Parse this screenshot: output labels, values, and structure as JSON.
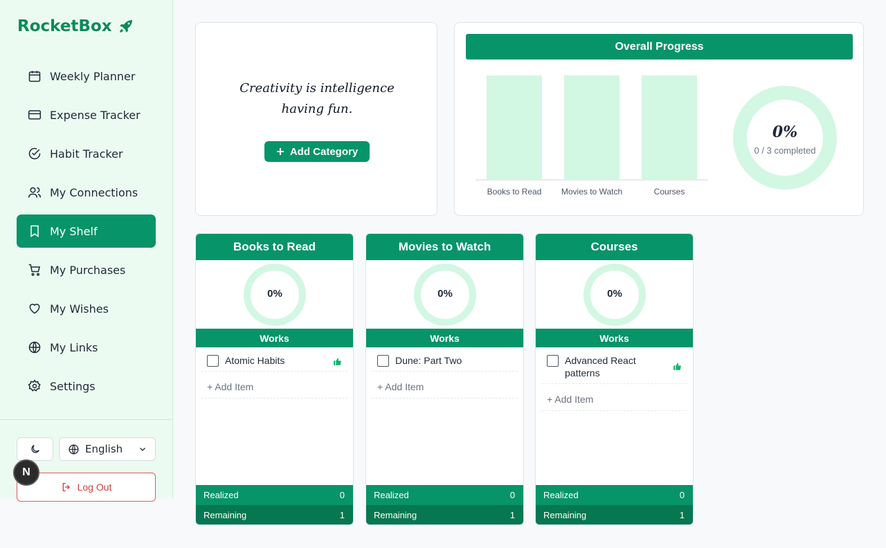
{
  "app": {
    "name": "RocketBox",
    "brand_icon": "rocket-icon",
    "accent_color": "#079468"
  },
  "sidebar": {
    "items": [
      {
        "label": "Weekly Planner",
        "icon": "calendar-icon"
      },
      {
        "label": "Expense Tracker",
        "icon": "credit-card-icon"
      },
      {
        "label": "Habit Tracker",
        "icon": "check-circle-icon"
      },
      {
        "label": "My Connections",
        "icon": "users-icon"
      },
      {
        "label": "My Shelf",
        "icon": "bookmark-icon",
        "active": true
      },
      {
        "label": "My Purchases",
        "icon": "cart-icon"
      },
      {
        "label": "My Wishes",
        "icon": "heart-icon"
      },
      {
        "label": "My Links",
        "icon": "globe-icon"
      },
      {
        "label": "Settings",
        "icon": "gear-icon"
      }
    ],
    "theme_icon": "moon-icon",
    "language": "English",
    "logout_label": "Log Out",
    "avatar_letter": "N"
  },
  "quote_card": {
    "quote": "Creativity is intelligence having fun.",
    "add_category_label": "Add Category"
  },
  "progress": {
    "header": "Overall Progress",
    "percent": "0%",
    "completed_text": "0 / 3 completed"
  },
  "chart_data": {
    "type": "bar",
    "categories": [
      "Books to Read",
      "Movies to Watch",
      "Courses"
    ],
    "values": [
      0,
      0,
      0
    ],
    "title": "",
    "xlabel": "",
    "ylabel": "",
    "ylim": [
      0,
      100
    ]
  },
  "categories": [
    {
      "title": "Books to Read",
      "percent": "0%",
      "section_label": "Works",
      "items": [
        {
          "text": "Atomic Habits",
          "liked": true
        }
      ],
      "add_item_label": "+ Add Item",
      "realized_label": "Realized",
      "realized_value": "0",
      "remaining_label": "Remaining",
      "remaining_value": "1"
    },
    {
      "title": "Movies to Watch",
      "percent": "0%",
      "section_label": "Works",
      "items": [
        {
          "text": "Dune: Part Two",
          "liked": false
        }
      ],
      "add_item_label": "+ Add Item",
      "realized_label": "Realized",
      "realized_value": "0",
      "remaining_label": "Remaining",
      "remaining_value": "1"
    },
    {
      "title": "Courses",
      "percent": "0%",
      "section_label": "Works",
      "items": [
        {
          "text": "Advanced React patterns",
          "liked": true
        }
      ],
      "add_item_label": "+ Add Item",
      "realized_label": "Realized",
      "realized_value": "0",
      "remaining_label": "Remaining",
      "remaining_value": "1"
    }
  ]
}
